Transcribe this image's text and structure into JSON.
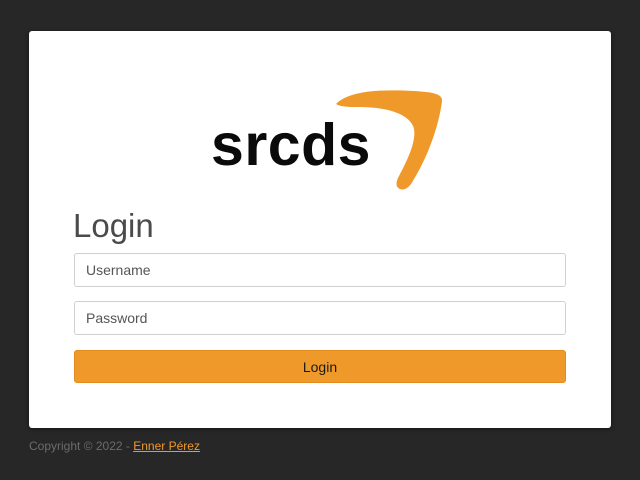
{
  "logo": {
    "text": "srcds",
    "accent_color": "#f0992b",
    "text_color": "#0a0a0a"
  },
  "login": {
    "title": "Login",
    "username_placeholder": "Username",
    "password_placeholder": "Password",
    "button_label": "Login",
    "button_color": "#f0992b"
  },
  "footer": {
    "copyright_prefix": "Copyright © 2022 - ",
    "author_link": "Enner Pérez"
  },
  "colors": {
    "background": "#272727",
    "card": "#ffffff"
  }
}
